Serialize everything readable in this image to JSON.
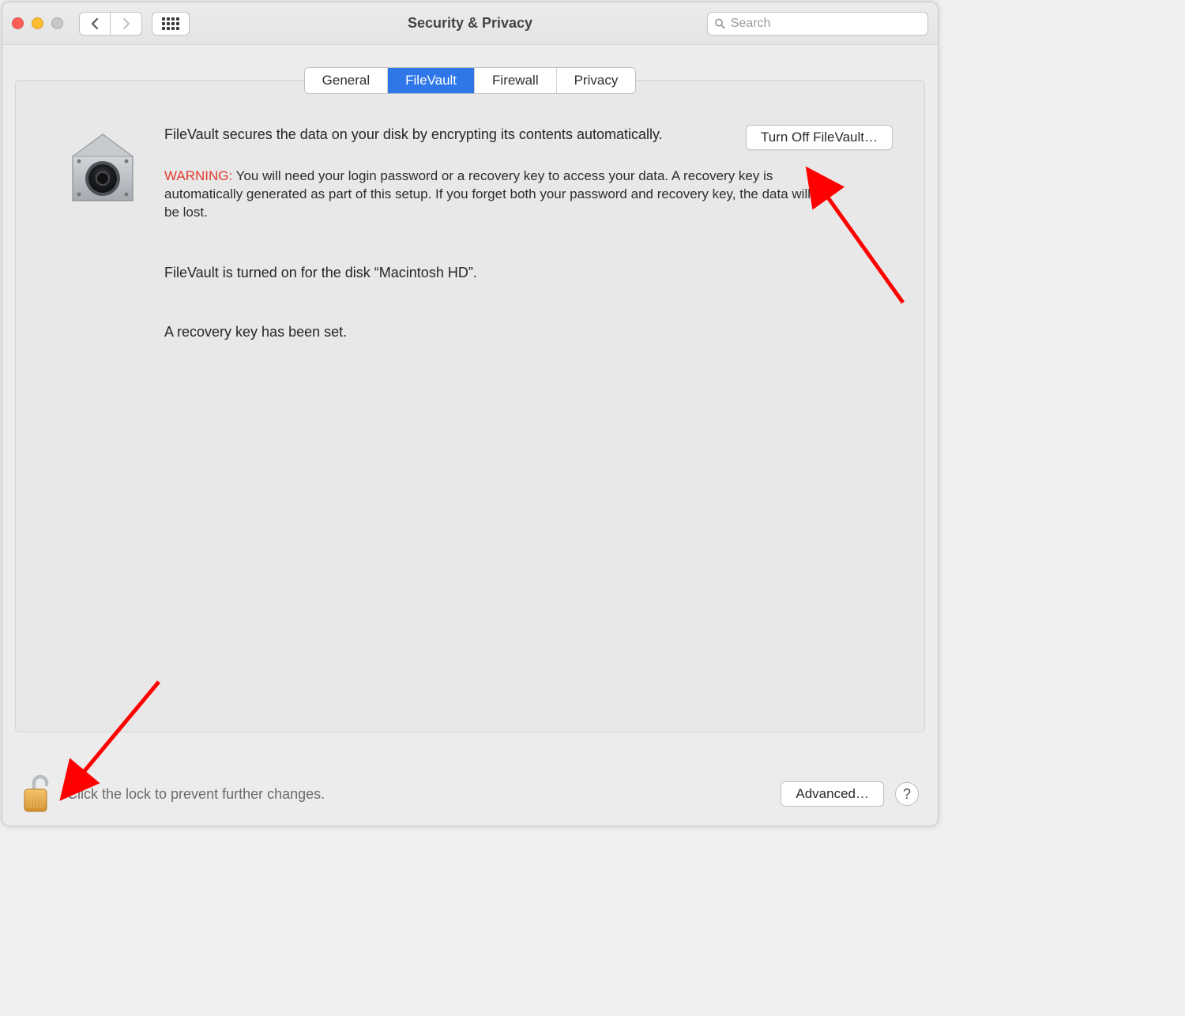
{
  "window": {
    "title": "Security & Privacy"
  },
  "search": {
    "placeholder": "Search"
  },
  "tabs": {
    "general": "General",
    "filevault": "FileVault",
    "firewall": "Firewall",
    "privacy": "Privacy",
    "active": "filevault"
  },
  "main": {
    "description": "FileVault secures the data on your disk by encrypting its contents automatically.",
    "action_label": "Turn Off FileVault…",
    "warning_label": "WARNING:",
    "warning_text": " You will need your login password or a recovery key to access your data. A recovery key is automatically generated as part of this setup. If you forget both your password and recovery key, the data will be lost.",
    "status_text": "FileVault is turned on for the disk “Macintosh HD”.",
    "recovery_text": "A recovery key has been set."
  },
  "footer": {
    "lock_text": "Click the lock to prevent further changes.",
    "advanced_label": "Advanced…",
    "help_label": "?"
  },
  "colors": {
    "accent": "#2f77e8",
    "warning": "#e33b2e",
    "annotation_arrow": "#ff0000"
  }
}
